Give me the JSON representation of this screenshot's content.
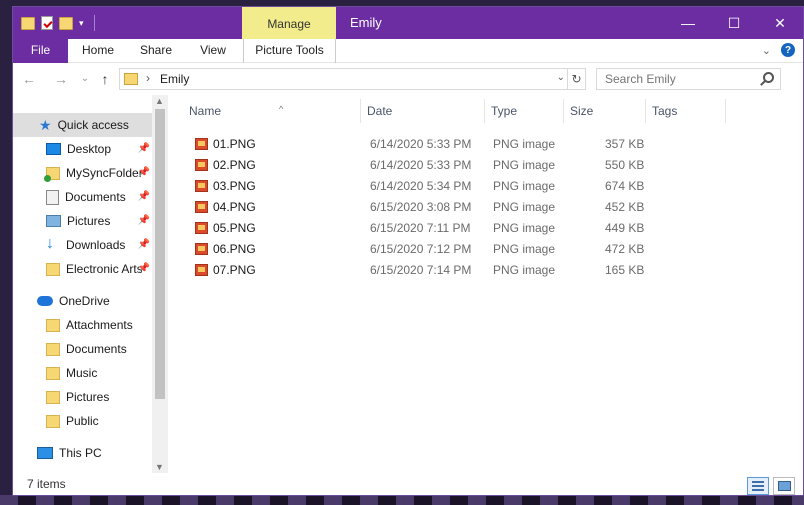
{
  "titlebar": {
    "window_title": "Emily",
    "manage_tab": "Manage",
    "minimize": "—",
    "maximize": "☐",
    "close": "✕",
    "qat_dropdown": "▾"
  },
  "ribbon": {
    "tabs": [
      "File",
      "Home",
      "Share",
      "View",
      "Picture Tools"
    ],
    "collapse": "⌄",
    "help": "?"
  },
  "address": {
    "back": "←",
    "forward": "→",
    "history": "⌄",
    "up": "↑",
    "separator": "›",
    "crumb": "Emily",
    "dropdown": "⌄",
    "refresh": "↻",
    "search_placeholder": "Search Emily"
  },
  "nav": {
    "quick_access": "Quick access",
    "items": [
      {
        "label": "Desktop",
        "pinned": true
      },
      {
        "label": "MySyncFolder",
        "pinned": true
      },
      {
        "label": "Documents",
        "pinned": true
      },
      {
        "label": "Pictures",
        "pinned": true
      },
      {
        "label": "Downloads",
        "pinned": true
      },
      {
        "label": "Electronic Arts",
        "pinned": true
      }
    ],
    "onedrive": "OneDrive",
    "onedrive_items": [
      "Attachments",
      "Documents",
      "Music",
      "Pictures",
      "Public"
    ],
    "this_pc": "This PC",
    "pin_glyph": "📌",
    "scroll_up": "▲",
    "scroll_down": "▼"
  },
  "columns": {
    "name": "Name",
    "date": "Date",
    "type": "Type",
    "size": "Size",
    "tags": "Tags",
    "sort_indicator": "^"
  },
  "files": [
    {
      "name": "01.PNG",
      "date": "6/14/2020 5:33 PM",
      "type": "PNG image",
      "size": "357 KB"
    },
    {
      "name": "02.PNG",
      "date": "6/14/2020 5:33 PM",
      "type": "PNG image",
      "size": "550 KB"
    },
    {
      "name": "03.PNG",
      "date": "6/14/2020 5:34 PM",
      "type": "PNG image",
      "size": "674 KB"
    },
    {
      "name": "04.PNG",
      "date": "6/15/2020 3:08 PM",
      "type": "PNG image",
      "size": "452 KB"
    },
    {
      "name": "05.PNG",
      "date": "6/15/2020 7:11 PM",
      "type": "PNG image",
      "size": "449 KB"
    },
    {
      "name": "06.PNG",
      "date": "6/15/2020 7:12 PM",
      "type": "PNG image",
      "size": "472 KB"
    },
    {
      "name": "07.PNG",
      "date": "6/15/2020 7:14 PM",
      "type": "PNG image",
      "size": "165 KB"
    }
  ],
  "status": {
    "item_count": "7 items"
  },
  "colors": {
    "accent": "#6c2ca2",
    "manage_tab": "#f2ec8c",
    "selection": "#dedede"
  }
}
